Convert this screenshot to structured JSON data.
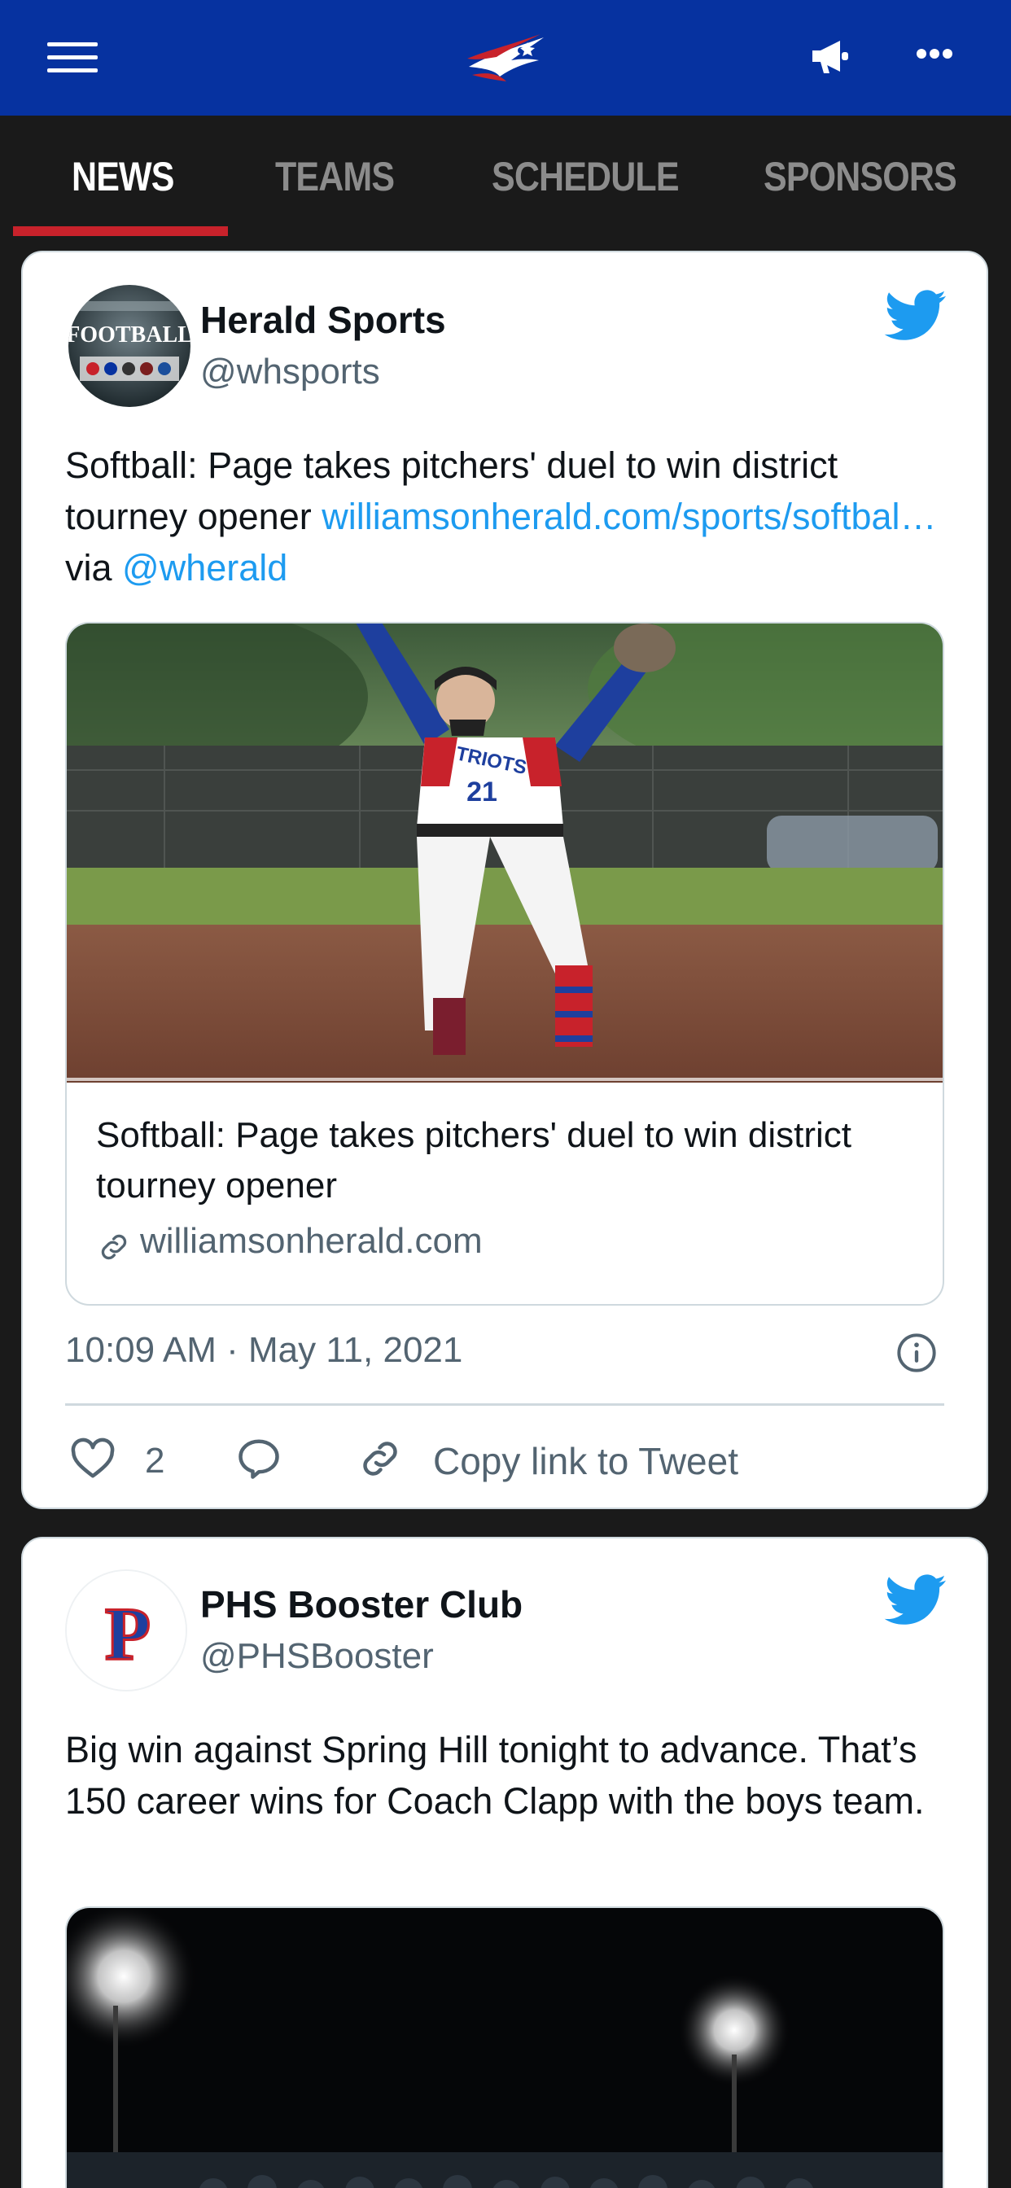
{
  "appbar": {
    "menu_icon": "hamburger-menu-icon",
    "logo": "patriots-eagle-logo",
    "announce_icon": "megaphone-icon",
    "more_icon": "more-dots-icon",
    "colors": {
      "bar": "#0632a0",
      "accent_red": "#c8222b"
    }
  },
  "tabs": [
    {
      "label": "NEWS",
      "active": true
    },
    {
      "label": "TEAMS",
      "active": false
    },
    {
      "label": "SCHEDULE",
      "active": false
    },
    {
      "label": "SPONSORS",
      "active": false
    }
  ],
  "tweets": [
    {
      "name": "Herald Sports",
      "handle": "@whsports",
      "avatar_text": "FOOTBALL",
      "text_plain_1": "Softball: Page takes pitchers' duel to win district tourney opener ",
      "link_1": "williamsonherald.com/sports/softbal…",
      "text_plain_2": " via ",
      "link_2": "@wherald",
      "card": {
        "title": "Softball: Page takes pitchers' duel to win district tourney opener",
        "domain": "williamsonherald.com",
        "jersey_text": "TRIOTS",
        "jersey_number": "21"
      },
      "timestamp": "10:09 AM · May 11, 2021",
      "likes": "2",
      "copy_label": "Copy link to Tweet"
    },
    {
      "name": "PHS Booster Club",
      "handle": "@PHSBooster",
      "avatar_text": "P",
      "text": "Big win against Spring Hill tonight to advance. That’s 150 career wins for Coach Clapp with the boys team."
    }
  ]
}
